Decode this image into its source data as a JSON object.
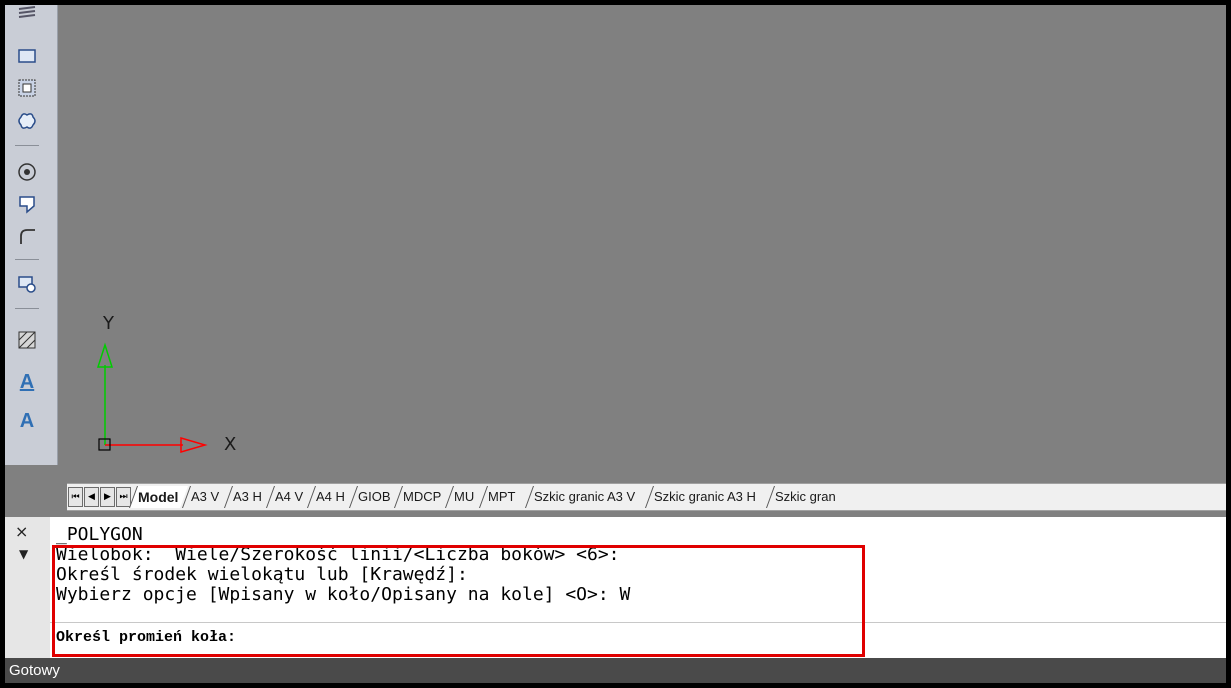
{
  "toolbar": {
    "icons": [
      "hatch-lines-icon",
      "rectangle-icon",
      "region-icon",
      "revcloud-icon",
      "donut-icon",
      "wipeout-icon",
      "fillet-icon",
      "block-icon",
      "gradient-hatch-icon",
      "multiline-text-icon",
      "text-icon"
    ],
    "text_icon_a": "A",
    "text_icon_b": "A"
  },
  "ucs": {
    "y_label": "Y",
    "x_label": "X",
    "x_color": "#ff0000",
    "y_color": "#00cc00"
  },
  "layout_tabs": {
    "nav": [
      "first",
      "prev",
      "next",
      "last"
    ],
    "tabs": [
      "Model",
      "A3 V",
      "A3 H",
      "A4 V",
      "A4 H",
      "GIOB",
      "MDCP",
      "MU",
      "MPT",
      "Szkic granic A3 V",
      "Szkic granic A3 H",
      "Szkic gran"
    ],
    "active": "Model"
  },
  "command": {
    "history": [
      "_POLYGON",
      "Wielobok:  Wiele/Szerokość linii/<Liczba boków> <6>:",
      "Określ środek wielokątu lub [Krawędź]:",
      "Wybierz opcje [Wpisany w koło/Opisany na kole] <O>: W"
    ],
    "prompt": "Określ promień koła:",
    "close_icon": "×",
    "menu_icon": "▼"
  },
  "status": {
    "text": "Gotowy"
  },
  "colors": {
    "highlight": "#e00000",
    "canvas": "#808080",
    "accent": "#2f6fb4"
  }
}
